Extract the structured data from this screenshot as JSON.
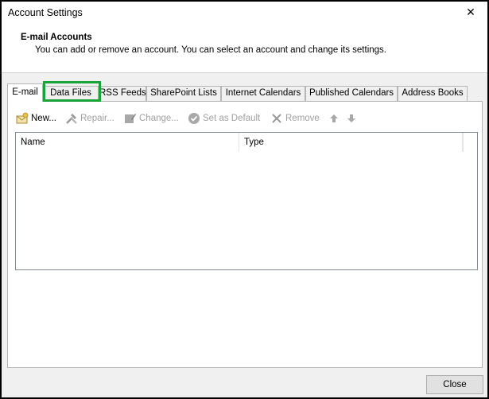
{
  "window": {
    "title": "Account Settings",
    "close_glyph": "✕"
  },
  "header": {
    "title": "E-mail Accounts",
    "description": "You can add or remove an account. You can select an account and change its settings."
  },
  "tabs": [
    {
      "label": "E-mail",
      "active": true
    },
    {
      "label": "Data Files",
      "highlighted": true
    },
    {
      "label": "RSS Feeds"
    },
    {
      "label": "SharePoint Lists"
    },
    {
      "label": "Internet Calendars"
    },
    {
      "label": "Published Calendars"
    },
    {
      "label": "Address Books"
    }
  ],
  "toolbar": {
    "new_label": "New...",
    "repair_label": "Repair...",
    "change_label": "Change...",
    "set_default_label": "Set as Default",
    "remove_label": "Remove"
  },
  "list": {
    "columns": [
      "Name",
      "Type"
    ]
  },
  "footer": {
    "close_label": "Close"
  },
  "colors": {
    "highlight": "#1aa33a",
    "disabled_text": "#a0a0a0"
  }
}
